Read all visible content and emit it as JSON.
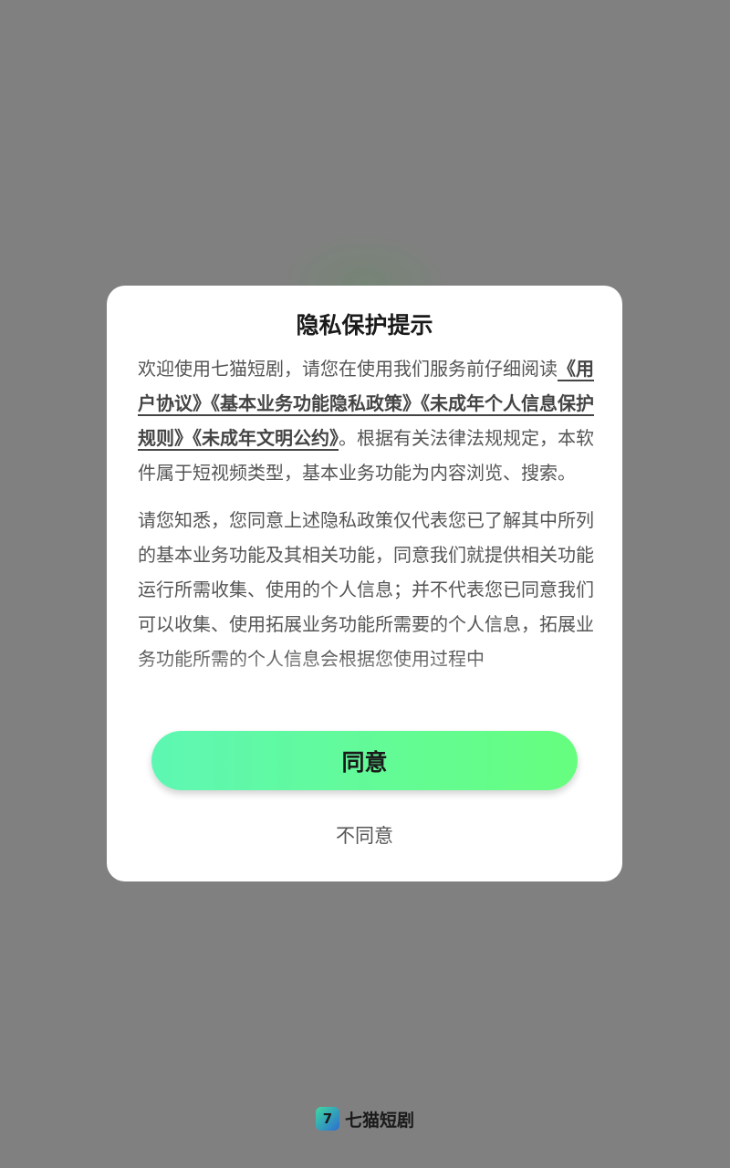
{
  "dialog": {
    "title": "隐私保护提示",
    "intro": "欢迎使用七猫短剧，请您在使用我们服务前仔细阅读",
    "links": [
      "《用户协议》",
      "《基本业务功能隐私政策》",
      "《未成年个人信息保护规则》",
      "《未成年文明公约》"
    ],
    "after_links": "。根据有关法律法规规定，本软件属于短视频类型，基本业务功能为内容浏览、搜索。",
    "paragraph2": "请您知悉，您同意上述隐私政策仅代表您已了解其中所列的基本业务功能及其相关功能，同意我们就提供相关功能运行所需收集、使用的个人信息；并不代表您已同意我们可以收集、使用拓展业务功能所需要的个人信息，拓展业务功能所需的个人信息会根据您使用过程中",
    "agree_label": "同意",
    "disagree_label": "不同意"
  },
  "brand": {
    "logo_glyph": "7",
    "name": "七猫短剧"
  },
  "colors": {
    "overlay": "#808080",
    "button_start": "#5ef7b3",
    "button_end": "#66fe7e"
  }
}
